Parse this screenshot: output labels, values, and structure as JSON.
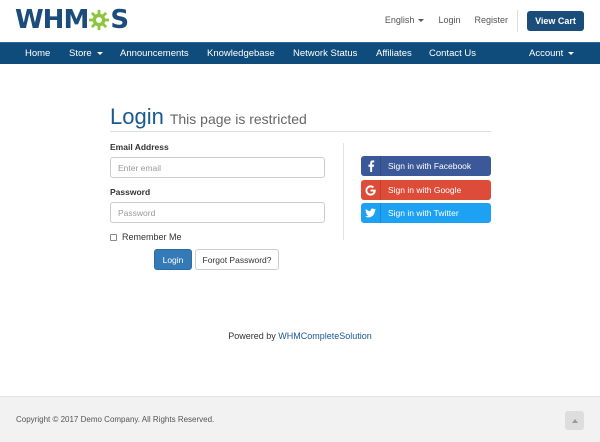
{
  "header": {
    "logo": {
      "part1": "WHM",
      "part2": "S"
    },
    "links": [
      {
        "label": "English",
        "has_caret": true
      },
      {
        "label": "Login"
      },
      {
        "label": "Register"
      }
    ],
    "view_cart_label": "View Cart"
  },
  "nav": {
    "items": [
      {
        "label": "Home"
      },
      {
        "label": "Store"
      },
      {
        "label": "Announcements"
      },
      {
        "label": "Knowledgebase"
      },
      {
        "label": "Network Status"
      },
      {
        "label": "Affiliates"
      },
      {
        "label": "Contact Us"
      }
    ],
    "account_label": "Account"
  },
  "login": {
    "title": "Login",
    "subtitle": "This page is restricted",
    "email_label": "Email Address",
    "email_placeholder": "Enter email",
    "password_label": "Password",
    "password_placeholder": "Password",
    "remember_label": "Remember Me",
    "login_button": "Login",
    "forgot_button": "Forgot Password?"
  },
  "social": {
    "facebook": "Sign in with Facebook",
    "google": "Sign in with Google",
    "twitter": "Sign in with Twitter"
  },
  "powered": {
    "prefix": "Powered by",
    "link": "WHMCompleteSolution"
  },
  "footer": {
    "copyright": "Copyright © 2017 Demo Company. All Rights Reserved."
  },
  "colors": {
    "brand": "#1b4c7c",
    "navbar": "#0f4c7c",
    "primary": "#337ab7",
    "gear_green": "#8cc63f",
    "facebook": "#3b5998",
    "google": "#dd4b39",
    "twitter": "#1da1f2"
  },
  "icons": {
    "logo_gear": "gear-icon",
    "facebook": "facebook-icon",
    "google": "google-icon",
    "twitter": "twitter-icon",
    "back_to_top": "chevron-up-icon"
  }
}
